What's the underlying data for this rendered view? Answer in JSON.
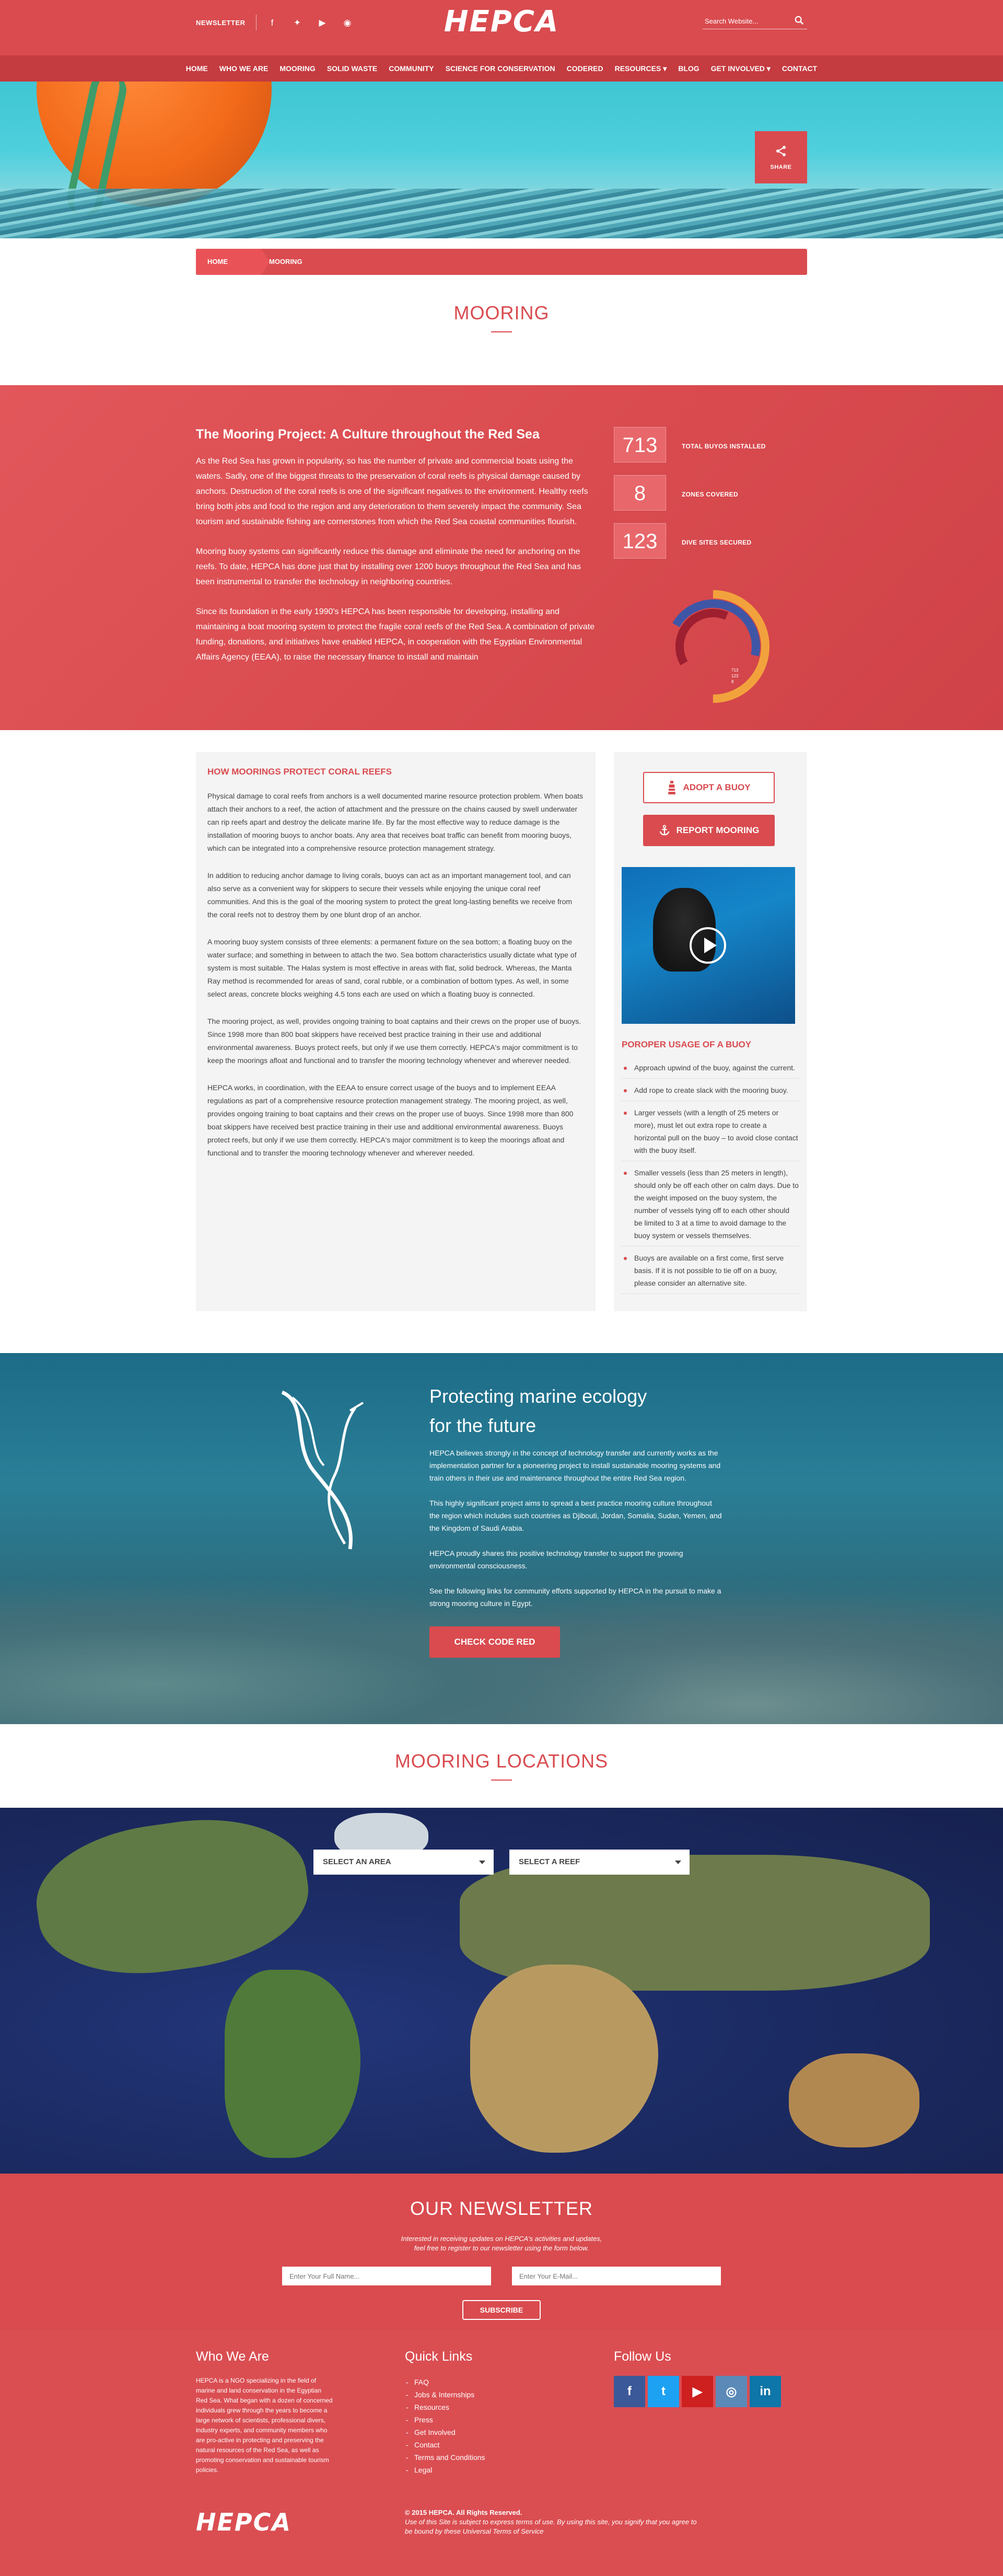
{
  "header": {
    "newsletter_label": "NEWSLETTER",
    "logo": "HEPCA",
    "search_placeholder": "Search Website...",
    "social": [
      "facebook-icon",
      "twitter-icon",
      "youtube-icon",
      "rss-icon"
    ],
    "nav": [
      "HOME",
      "WHO WE ARE",
      "MOORING",
      "SOLID WASTE",
      "COMMUNITY",
      "SCIENCE FOR CONSERVATION",
      "CODERED",
      "RESOURCES ▾",
      "BLOG",
      "GET INVOLVED ▾",
      "CONTACT"
    ]
  },
  "hero": {
    "share_label": "SHARE"
  },
  "breadcrumb": {
    "home": "HOME",
    "current": "MOORING"
  },
  "page_title": "MOORING",
  "intro": {
    "heading": "The Mooring Project: A Culture throughout the Red Sea",
    "paragraphs": [
      "As the Red Sea has grown in popularity, so has the number of private and commercial boats using the waters. Sadly, one of the biggest threats to the preservation of coral reefs is physical damage caused by anchors. Destruction of the coral reefs is one of the significant negatives to the environment. Healthy reefs bring both jobs and food to the region and any deterioration to them severely impact the community. Sea tourism and sustainable fishing are cornerstones from which the Red Sea coastal communities flourish.",
      "Mooring buoy systems can significantly reduce this damage and eliminate the need for anchoring on the reefs. To date, HEPCA has done just that by installing over 1200 buoys throughout the Red Sea and has been instrumental to transfer the technology in neighboring countries.",
      "Since its foundation in the early 1990's HEPCA has been responsible for developing, installing and maintaining a boat mooring system to protect the fragile coral reefs of the Red Sea. A combination of private funding, donations, and initiatives have enabled HEPCA, in cooperation with the Egyptian Environmental Affairs Agency (EEAA), to raise the necessary finance to install and maintain"
    ],
    "stats": [
      {
        "value": "713",
        "label": "TOTAL BUYOS INSTALLED"
      },
      {
        "value": "8",
        "label": "ZONES COVERED"
      },
      {
        "value": "123",
        "label": "DIVE SITES SECURED"
      }
    ],
    "donut": {
      "rings": [
        {
          "color": "#f2a23c",
          "fraction": 0.5
        },
        {
          "color": "#3f56a6",
          "fraction": 0.45
        },
        {
          "color": "#9e1f2f",
          "fraction": 0.4
        }
      ],
      "labels": [
        "713",
        "123",
        "8"
      ]
    }
  },
  "how": {
    "heading": "HOW MOORINGS PROTECT CORAL REEFS",
    "paragraphs": [
      "Physical damage to coral reefs from anchors is a well documented marine resource protection problem. When boats attach their anchors to a reef, the action of attachment and the pressure on the chains caused by swell underwater can rip reefs apart and destroy the delicate marine life. By far the most effective way to reduce damage is the installation of mooring buoys to anchor boats. Any area that receives boat traffic can benefit from mooring buoys, which can be integrated into a comprehensive resource protection management strategy.",
      "In addition to reducing anchor damage to living corals, buoys can act as an important management tool, and can also serve as a convenient way for skippers to secure their vessels while enjoying the unique coral reef communities. And this is the goal of the mooring system to protect the great long-lasting benefits we receive from the coral reefs not to destroy them by one blunt drop of an anchor.",
      "A mooring buoy system consists of three elements: a permanent fixture on the sea bottom; a floating buoy on the water surface; and something in between to attach the two. Sea bottom characteristics usually dictate what type of system is most suitable. The Halas system is most effective in areas with flat, solid bedrock. Whereas, the Manta Ray method is recommended for areas of sand, coral rubble, or a combination of bottom types. As well, in some select areas, concrete blocks weighing 4.5 tons each are used on which a floating buoy is connected.",
      "The mooring project, as well, provides ongoing training to boat captains and their crews on the proper use of buoys. Since 1998 more than 800 boat skippers have received best practice training in their use and additional environmental awareness. Buoys protect reefs, but only if we use them correctly. HEPCA's major commitment is to keep the moorings afloat and functional and to transfer the mooring technology whenever and wherever needed.",
      "HEPCA works, in coordination, with the EEAA to ensure correct usage of the buoys and to implement EEAA regulations as part of a comprehensive resource protection management strategy. The mooring project, as well, provides ongoing training to boat captains and their crews on the proper use of buoys. Since 1998 more than 800 boat skippers have received best practice training in their use and additional environmental awareness. Buoys protect reefs, but only if we use them correctly. HEPCA's major commitment is to keep the moorings afloat and functional and to transfer the mooring technology whenever and wherever needed."
    ],
    "adopt_label": "ADOPT A BUOY",
    "report_label": "REPORT MOORING",
    "usage_heading": "POROPER USAGE OF A BUOY",
    "usage": [
      "Approach upwind of the buoy, against the current.",
      "Add rope to create slack with the mooring buoy.",
      "Larger vessels (with a length of 25 meters or more), must let out extra rope to create a horizontal pull on the buoy – to avoid close contact with the buoy itself.",
      "Smaller vessels (less than 25 meters in length), should only be off each other on calm days. Due to the weight imposed on the buoy system, the number of vessels tying off to each other should be limited to 3 at a time to avoid damage to the buoy system or vessels themselves.",
      "Buoys are available on a first come, first serve basis. If it is not possible to tie off on a buoy, please consider an alternative site."
    ]
  },
  "eco": {
    "heading_1": "Protecting marine ecology",
    "heading_2": "for the future",
    "paragraphs": [
      "HEPCA believes strongly in the concept of technology transfer and currently works as the implementation partner for a pioneering project to install sustainable mooring systems and train others in their use and maintenance throughout the entire Red Sea region.",
      "This highly significant project aims to spread a best practice mooring culture throughout the region which includes such countries as Djibouti, Jordan, Somalia, Sudan, Yemen, and the Kingdom of Saudi Arabia.",
      "HEPCA proudly shares this positive technology transfer to support the growing environmental consciousness.",
      "See the following links for community efforts supported by HEPCA in the pursuit to make a strong mooring culture in Egypt."
    ],
    "button": "CHECK CODE RED"
  },
  "locations": {
    "title": "MOORING LOCATIONS",
    "area_select": "SELECT AN AREA",
    "reef_select": "SELECT A REEF"
  },
  "newsletter": {
    "title": "OUR NEWSLETTER",
    "text_1": "Interested in receiving updates on HEPCA's activities and updates,",
    "text_2": "feel free to register to our newsletter using the form below.",
    "name_placeholder": "Enter Your Full Name...",
    "email_placeholder": "Enter Your E-Mail...",
    "button": "SUBSCRIBE"
  },
  "footer": {
    "who_title": "Who We Are",
    "who_text": "HEPCA is a NGO specializing in the field of marine and land conservation in the Egyptian Red Sea. What began with a dozen of concerned individuals grew through the years to become a large network of scientists, professional divers, industry experts, and community members who are pro-active in protecting and preserving the natural resources of the Red Sea, as well as promoting conservation and sustainable tourism policies.",
    "quick_title": "Quick Links",
    "links": [
      "FAQ",
      "Jobs & Internships",
      "Resources",
      "Press",
      "Get Involved",
      "Contact",
      "Terms and Conditions",
      "Legal"
    ],
    "follow_title": "Follow Us",
    "social": [
      {
        "icon": "facebook-icon",
        "glyph": "f",
        "color": "#3b5998"
      },
      {
        "icon": "twitter-icon",
        "glyph": "t",
        "color": "#1da1f2"
      },
      {
        "icon": "youtube-icon",
        "glyph": "▶",
        "color": "#cd201f"
      },
      {
        "icon": "instagram-icon",
        "glyph": "◎",
        "color": "#5b8ab8"
      },
      {
        "icon": "linkedin-icon",
        "glyph": "in",
        "color": "#0e76a8"
      }
    ],
    "logo": "HEPCA",
    "copyright": "© 2015 HEPCA. All Rights Reserved.",
    "terms_1": "Use of this Site is subject to express terms of use. By using this site, you signify that you agree to",
    "terms_2": "be bound by these Universal Terms of Service"
  }
}
